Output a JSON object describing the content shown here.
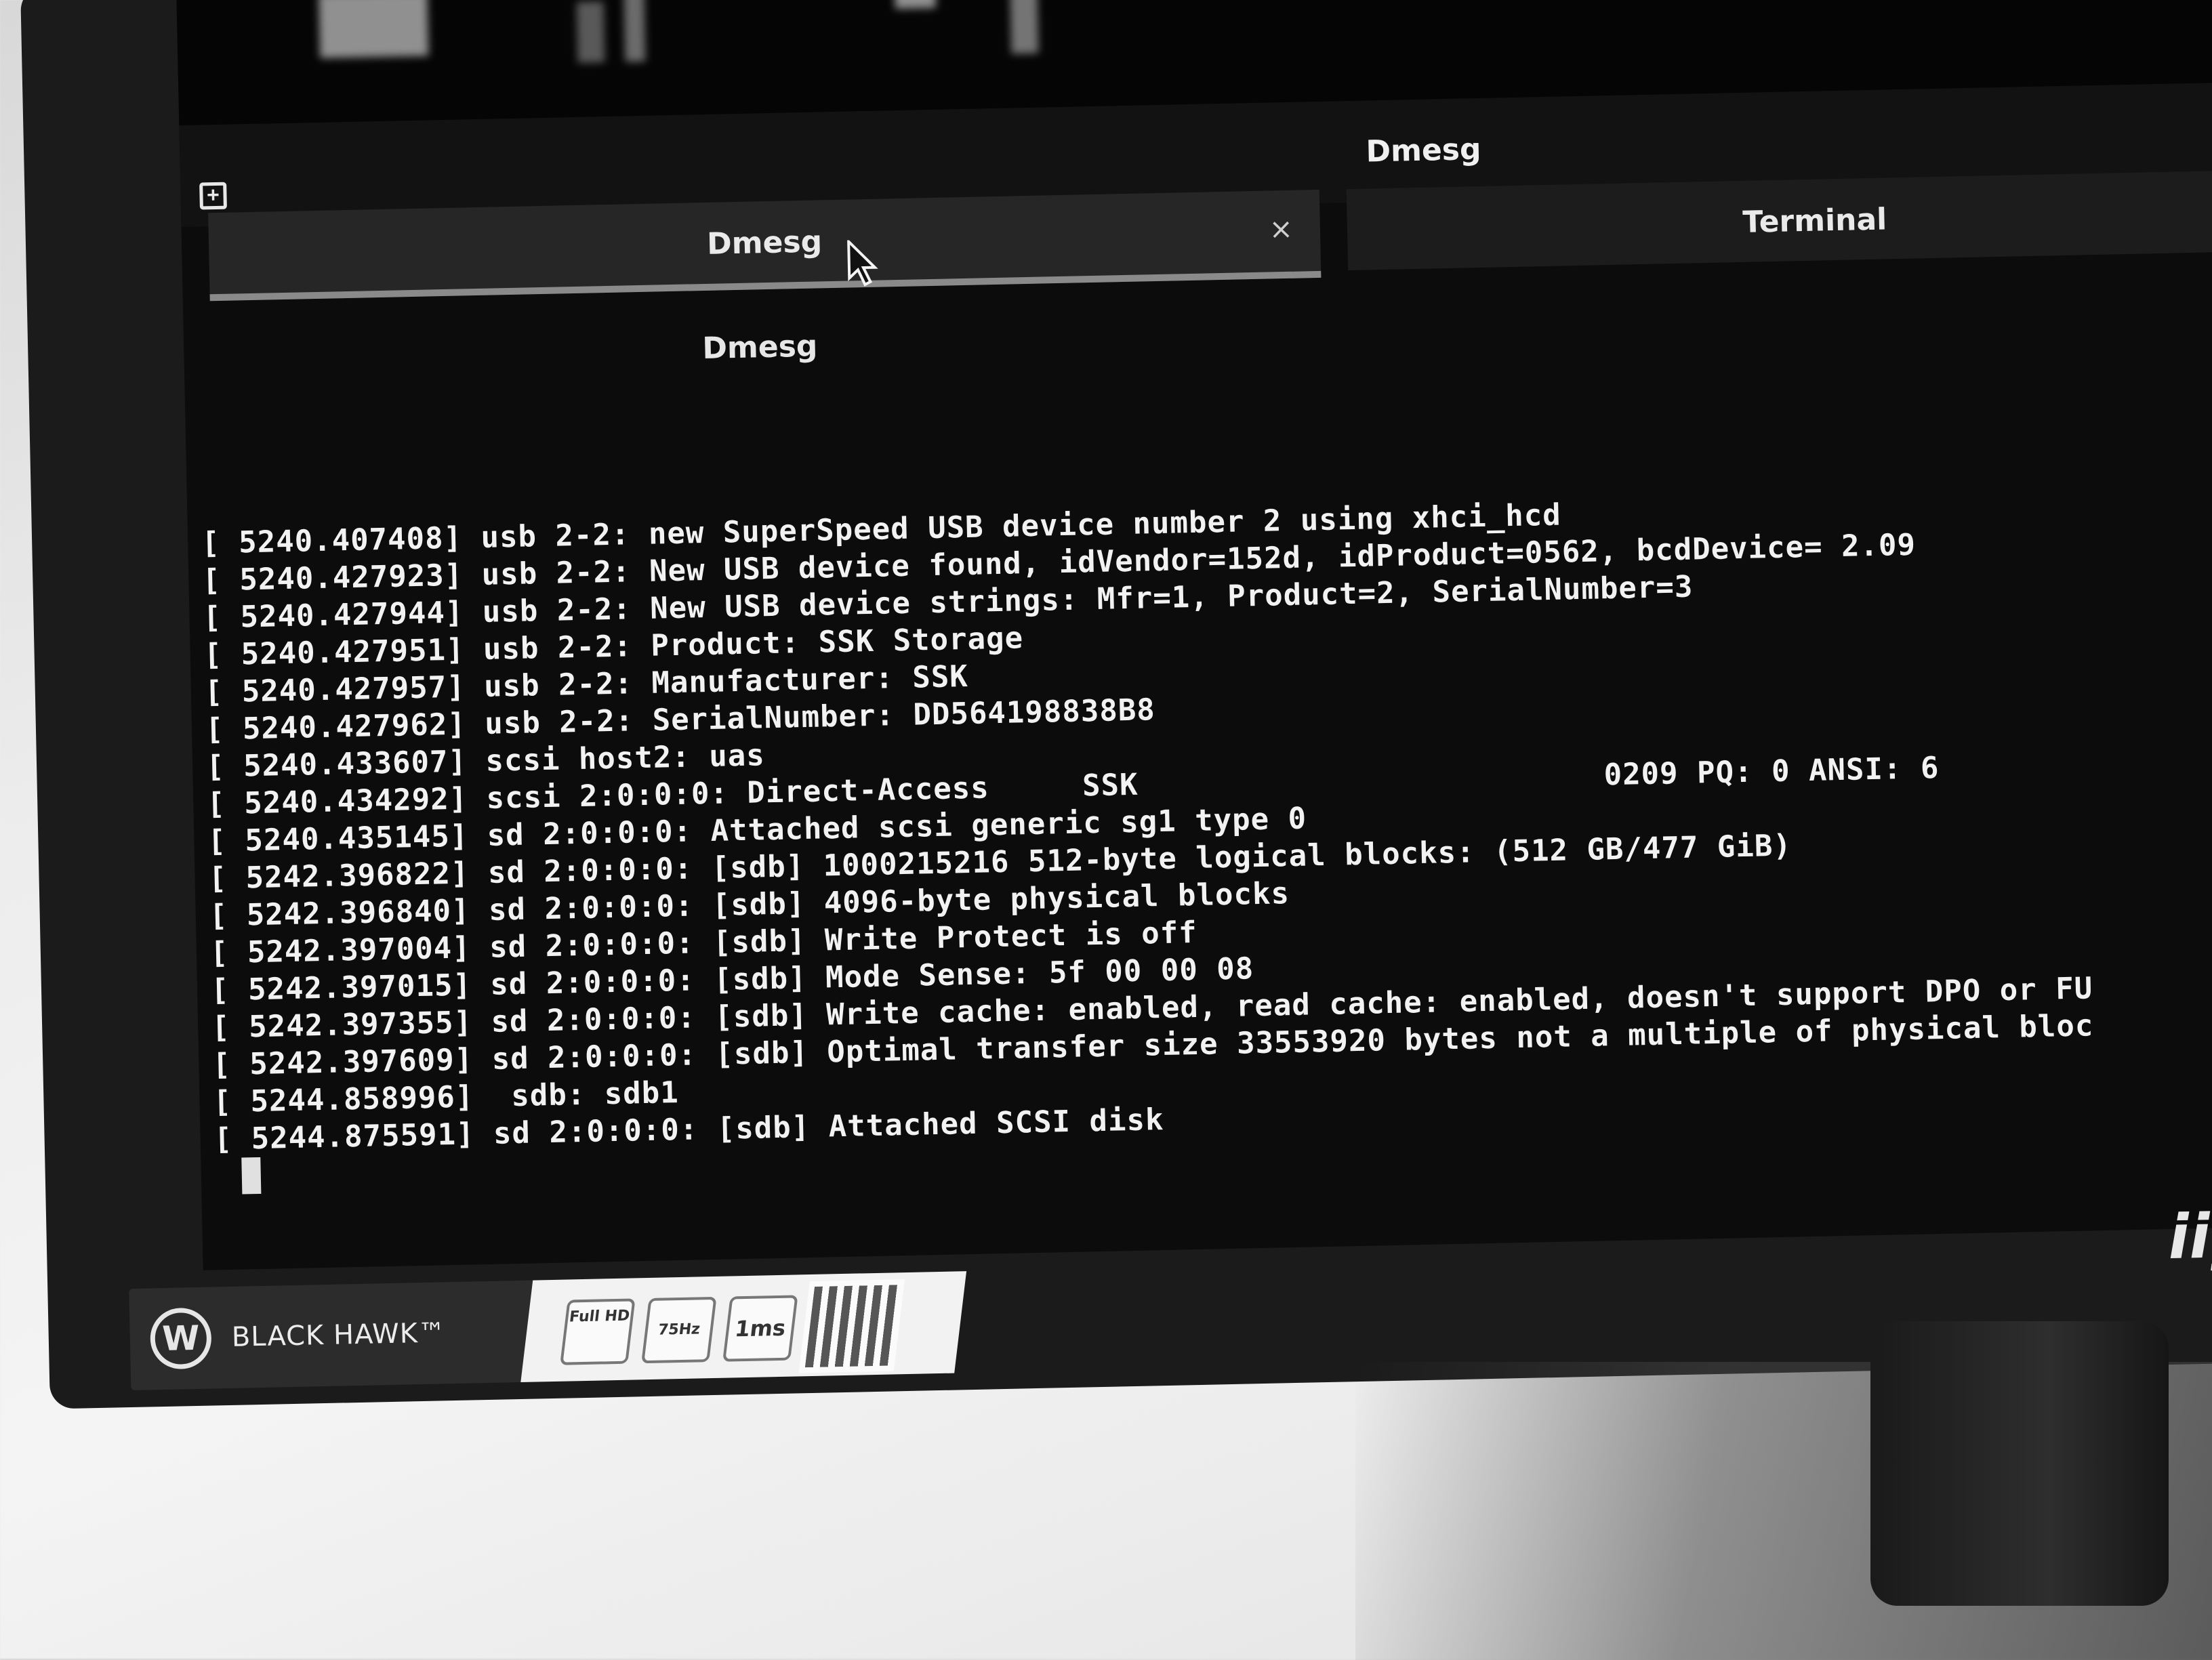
{
  "window": {
    "title": "Dmesg"
  },
  "tabs": [
    {
      "label": "Dmesg",
      "active": true,
      "close_glyph": "×"
    },
    {
      "label": "Terminal",
      "active": false
    }
  ],
  "content_title": "Dmesg",
  "log_lines": [
    "[ 5240.407408] usb 2-2: new SuperSpeed USB device number 2 using xhci_hcd",
    "[ 5240.427923] usb 2-2: New USB device found, idVendor=152d, idProduct=0562, bcdDevice= 2.09",
    "[ 5240.427944] usb 2-2: New USB device strings: Mfr=1, Product=2, SerialNumber=3",
    "[ 5240.427951] usb 2-2: Product: SSK Storage",
    "[ 5240.427957] usb 2-2: Manufacturer: SSK",
    "[ 5240.427962] usb 2-2: SerialNumber: DD564198838B8",
    "[ 5240.433607] scsi host2: uas",
    "[ 5240.434292] scsi 2:0:0:0: Direct-Access     SSK                         0209 PQ: 0 ANSI: 6",
    "[ 5240.435145] sd 2:0:0:0: Attached scsi generic sg1 type 0",
    "[ 5242.396822] sd 2:0:0:0: [sdb] 1000215216 512-byte logical blocks: (512 GB/477 GiB)",
    "[ 5242.396840] sd 2:0:0:0: [sdb] 4096-byte physical blocks",
    "[ 5242.397004] sd 2:0:0:0: [sdb] Write Protect is off",
    "[ 5242.397015] sd 2:0:0:0: [sdb] Mode Sense: 5f 00 00 08",
    "[ 5242.397355] sd 2:0:0:0: [sdb] Write cache: enabled, read cache: enabled, doesn't support DPO or FU",
    "[ 5242.397609] sd 2:0:0:0: [sdb] Optimal transfer size 33553920 bytes not a multiple of physical bloc",
    "[ 5244.858996]  sdb: sdb1",
    "[ 5244.875591] sd 2:0:0:0: [sdb] Attached SCSI disk"
  ],
  "monitor": {
    "brand": "BLACK HAWK™",
    "badges": [
      "Full HD",
      "75Hz",
      "1ms"
    ],
    "logo": "iiya"
  },
  "icons": {
    "new_tab": "new-tab-icon",
    "close": "close-icon",
    "cursor": "mouse-pointer-icon"
  }
}
